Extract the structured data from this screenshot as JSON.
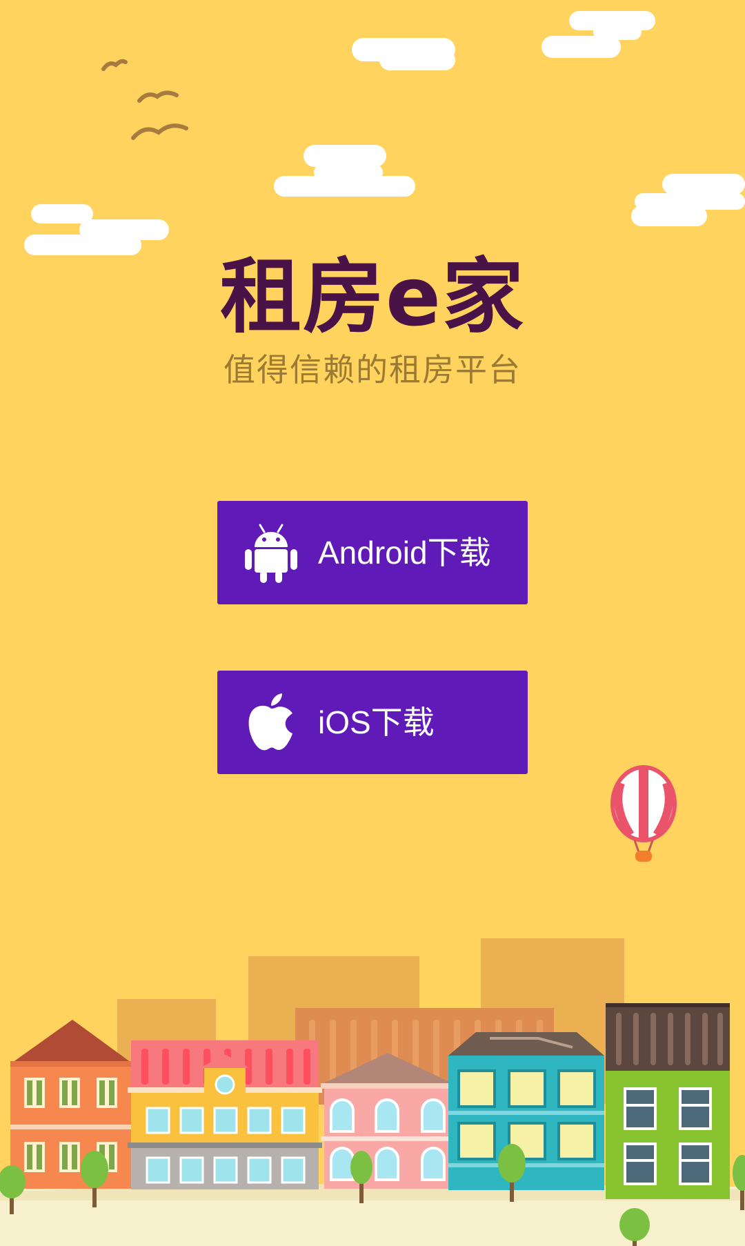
{
  "app": {
    "title": "租房e家",
    "subtitle": "值得信赖的租房平台"
  },
  "buttons": {
    "android_label": "Android下载",
    "ios_label": "iOS下载"
  },
  "icons": {
    "android": "android-icon",
    "apple": "apple-icon"
  },
  "colors": {
    "background": "#ffd35e",
    "title": "#4a1347",
    "subtitle": "#9b7a33",
    "button": "#5f1ab8",
    "button_text": "#ffffff"
  }
}
